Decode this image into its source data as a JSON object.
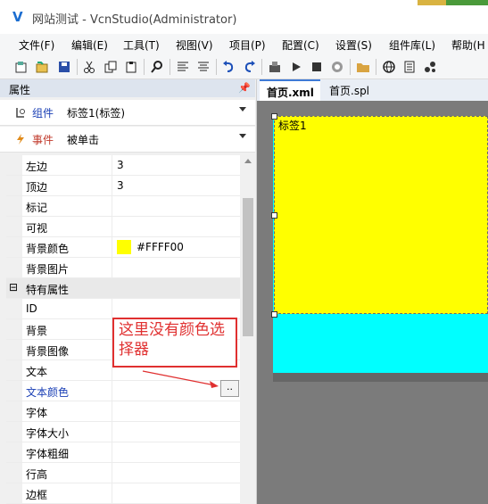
{
  "window": {
    "title": "网站测试 - VcnStudio(Administrator)",
    "logo": "V"
  },
  "menu": [
    "文件(F)",
    "编辑(E)",
    "工具(T)",
    "视图(V)",
    "项目(P)",
    "配置(C)",
    "设置(S)",
    "组件库(L)",
    "帮助(H"
  ],
  "toolbar": {
    "icons": [
      "new-icon",
      "open-icon",
      "save-icon",
      "cut-icon",
      "copy-icon",
      "paste-icon",
      "search-icon",
      "align-left-icon",
      "align-center-icon",
      "undo-icon",
      "redo-icon",
      "build-icon",
      "run-icon",
      "stop-icon",
      "debug-icon",
      "folder-icon",
      "globe-icon",
      "document-icon",
      "plugin-icon"
    ]
  },
  "panel": {
    "title": "属性",
    "component": {
      "label": "组件",
      "value": "标签1(标签)"
    },
    "event": {
      "label": "事件",
      "value": "被单击"
    },
    "rows": [
      {
        "name": "左边",
        "value": "3"
      },
      {
        "name": "顶边",
        "value": "3"
      },
      {
        "name": "标记",
        "value": ""
      },
      {
        "name": "可视",
        "value": ""
      },
      {
        "name": "背景颜色",
        "value": "#FFFF00"
      },
      {
        "name": "背景图片",
        "value": ""
      },
      {
        "name": "特有属性",
        "value": ""
      },
      {
        "name": "ID",
        "value": ""
      },
      {
        "name": "背景",
        "value": ""
      },
      {
        "name": "背景图像",
        "value": ""
      },
      {
        "name": "文本",
        "value": ""
      },
      {
        "name": "文本颜色",
        "value": ""
      },
      {
        "name": "字体",
        "value": ""
      },
      {
        "name": "字体大小",
        "value": ""
      },
      {
        "name": "字体粗细",
        "value": ""
      },
      {
        "name": "行高",
        "value": ""
      },
      {
        "name": "边框",
        "value": ""
      }
    ],
    "section_toggle": "⊟",
    "ellipsis": ".."
  },
  "annotation": {
    "text": "这里没有颜色选择器"
  },
  "editor": {
    "tabs": [
      "首页.xml",
      "首页.spl"
    ],
    "label_text": "标签1"
  },
  "colors": {
    "label_bg": "#FFFF00",
    "page_bg": "#00FFFF",
    "accent": "#e03030"
  }
}
